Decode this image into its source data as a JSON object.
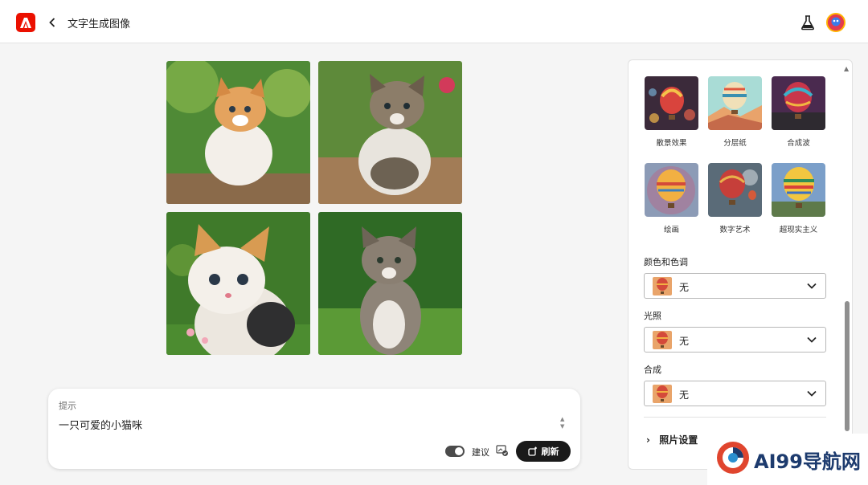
{
  "header": {
    "title": "文字生成图像",
    "icons": [
      "adobe-logo",
      "back-chevron",
      "labs-flask",
      "user-avatar"
    ]
  },
  "images": [
    {
      "alt": "kitten-1"
    },
    {
      "alt": "kitten-2"
    },
    {
      "alt": "kitten-3"
    },
    {
      "alt": "kitten-4"
    }
  ],
  "prompt": {
    "label": "提示",
    "value": "一只可爱的小猫咪",
    "suggest_label": "建议",
    "refresh_label": "刷新"
  },
  "panel": {
    "styles": [
      {
        "label": "散景效果"
      },
      {
        "label": "分层纸"
      },
      {
        "label": "合成波"
      },
      {
        "label": "绘画"
      },
      {
        "label": "数字艺术"
      },
      {
        "label": "超现实主义"
      }
    ],
    "color_tone": {
      "label": "颜色和色调",
      "value": "无"
    },
    "lighting": {
      "label": "光照",
      "value": "无"
    },
    "composition": {
      "label": "合成",
      "value": "无"
    },
    "photo_settings_label": "照片设置"
  },
  "watermark": {
    "text": "AI99导航网"
  },
  "colors": {
    "accent": "#eb1000",
    "button": "#1a1a1a"
  }
}
